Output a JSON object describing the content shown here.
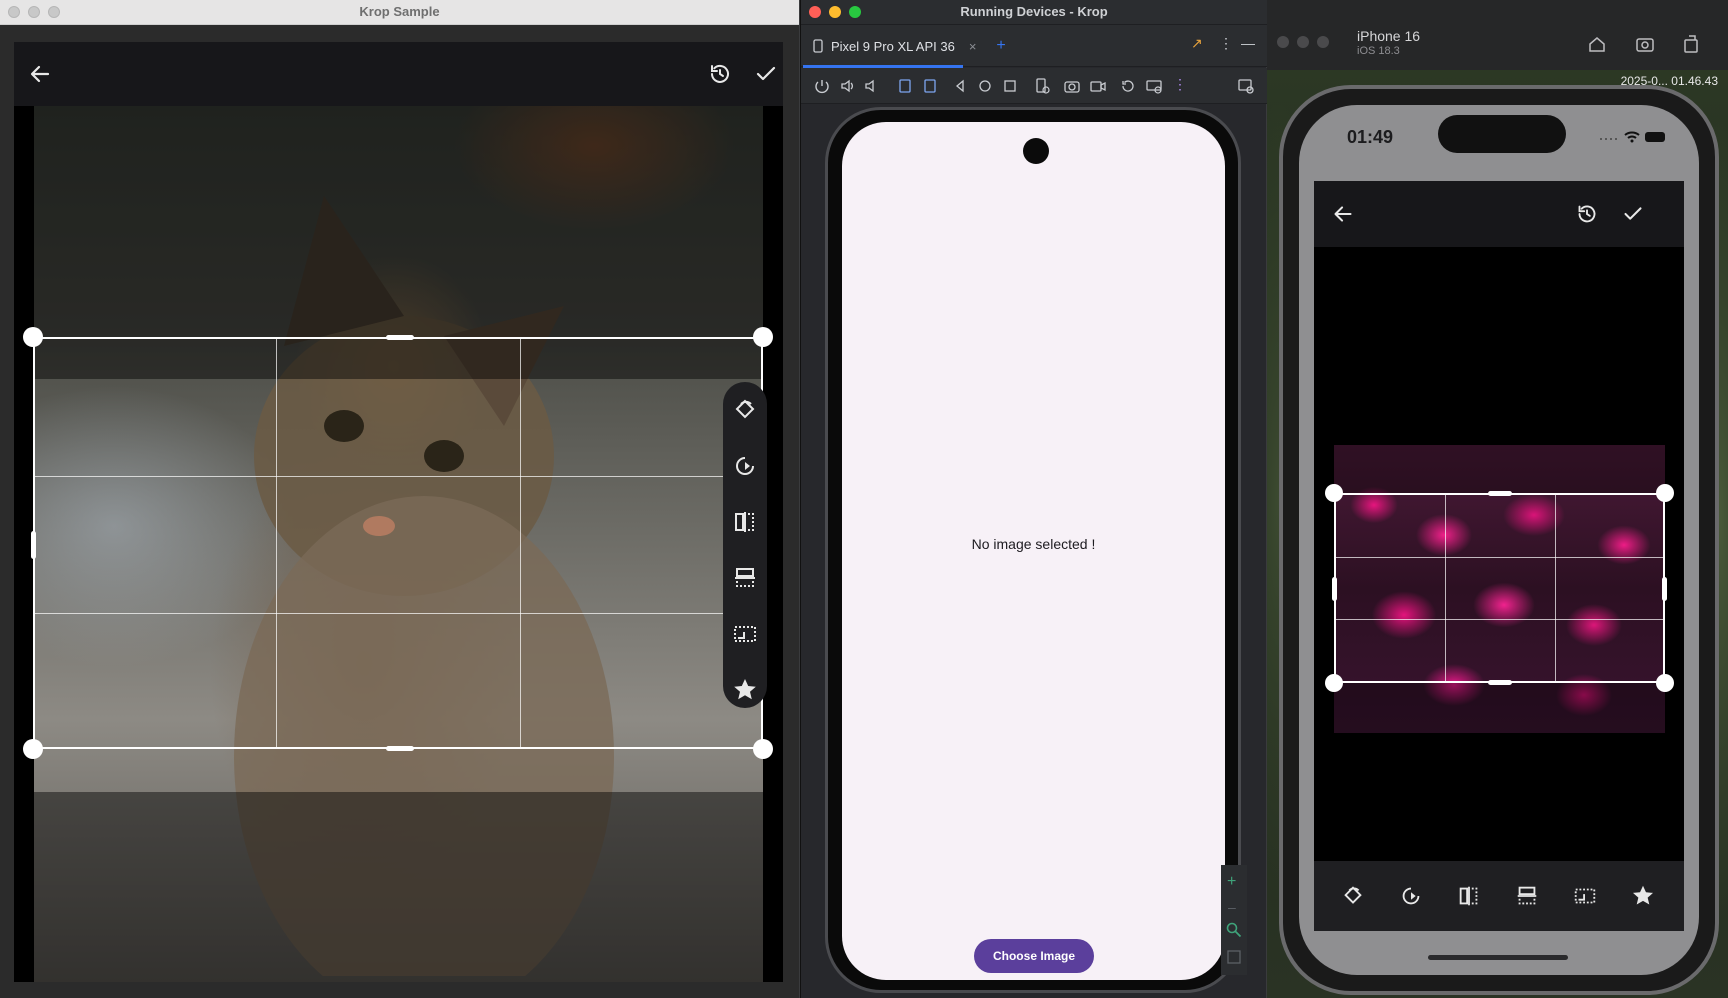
{
  "left_window": {
    "title": "Krop Sample"
  },
  "middle_window": {
    "title": "Running Devices - Krop",
    "tab_label": "Pixel 9 Pro XL API 36",
    "empty_message": "No image selected !",
    "choose_button_label": "Choose Image"
  },
  "right_window": {
    "device_name": "iPhone 16",
    "os_version": "iOS 18.3",
    "corner_clock": "2025-0... 01.46.43",
    "phone_time": "01:49"
  },
  "colors": {
    "accent_purple": "#5b3f9c",
    "ide_blue": "#3574f0",
    "flower_magenta": "#e6157e",
    "window_red": "#ff5f57",
    "window_yellow": "#febc2e",
    "window_green": "#28c840"
  },
  "icons": {
    "back": "arrow-left-icon",
    "reset": "history-icon",
    "confirm": "check-icon",
    "rotate_left": "rotate-left-icon",
    "rotate_right": "rotate-right-icon",
    "flip_horizontal": "flip-horizontal-icon",
    "flip_vertical": "flip-vertical-icon",
    "aspect_ratio": "aspect-ratio-icon",
    "shape": "star-icon"
  }
}
